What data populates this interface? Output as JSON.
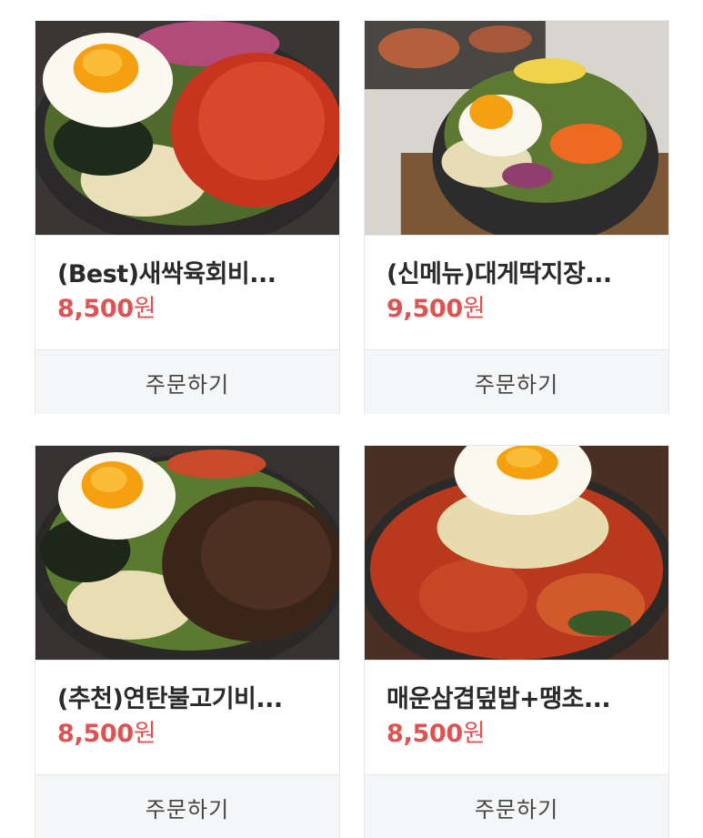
{
  "products": [
    {
      "title": "(Best)새싹육회비...",
      "price": "8,500",
      "currency": "원",
      "order_label": "주문하기",
      "image_icon": "bibimbap-yukhoe-photo"
    },
    {
      "title": "(신메뉴)대게딱지장...",
      "price": "9,500",
      "currency": "원",
      "order_label": "주문하기",
      "image_icon": "bibimbap-crab-photo"
    },
    {
      "title": "(추천)연탄불고기비...",
      "price": "8,500",
      "currency": "원",
      "order_label": "주문하기",
      "image_icon": "bibimbap-bulgogi-photo"
    },
    {
      "title": "매운삼겹덮밥+땡초...",
      "price": "8,500",
      "currency": "원",
      "order_label": "주문하기",
      "image_icon": "spicy-pork-rice-bowl-photo"
    }
  ],
  "colors": {
    "price": "#e05252",
    "border": "#e4e6ea",
    "button_bg": "#f5f6f8"
  }
}
